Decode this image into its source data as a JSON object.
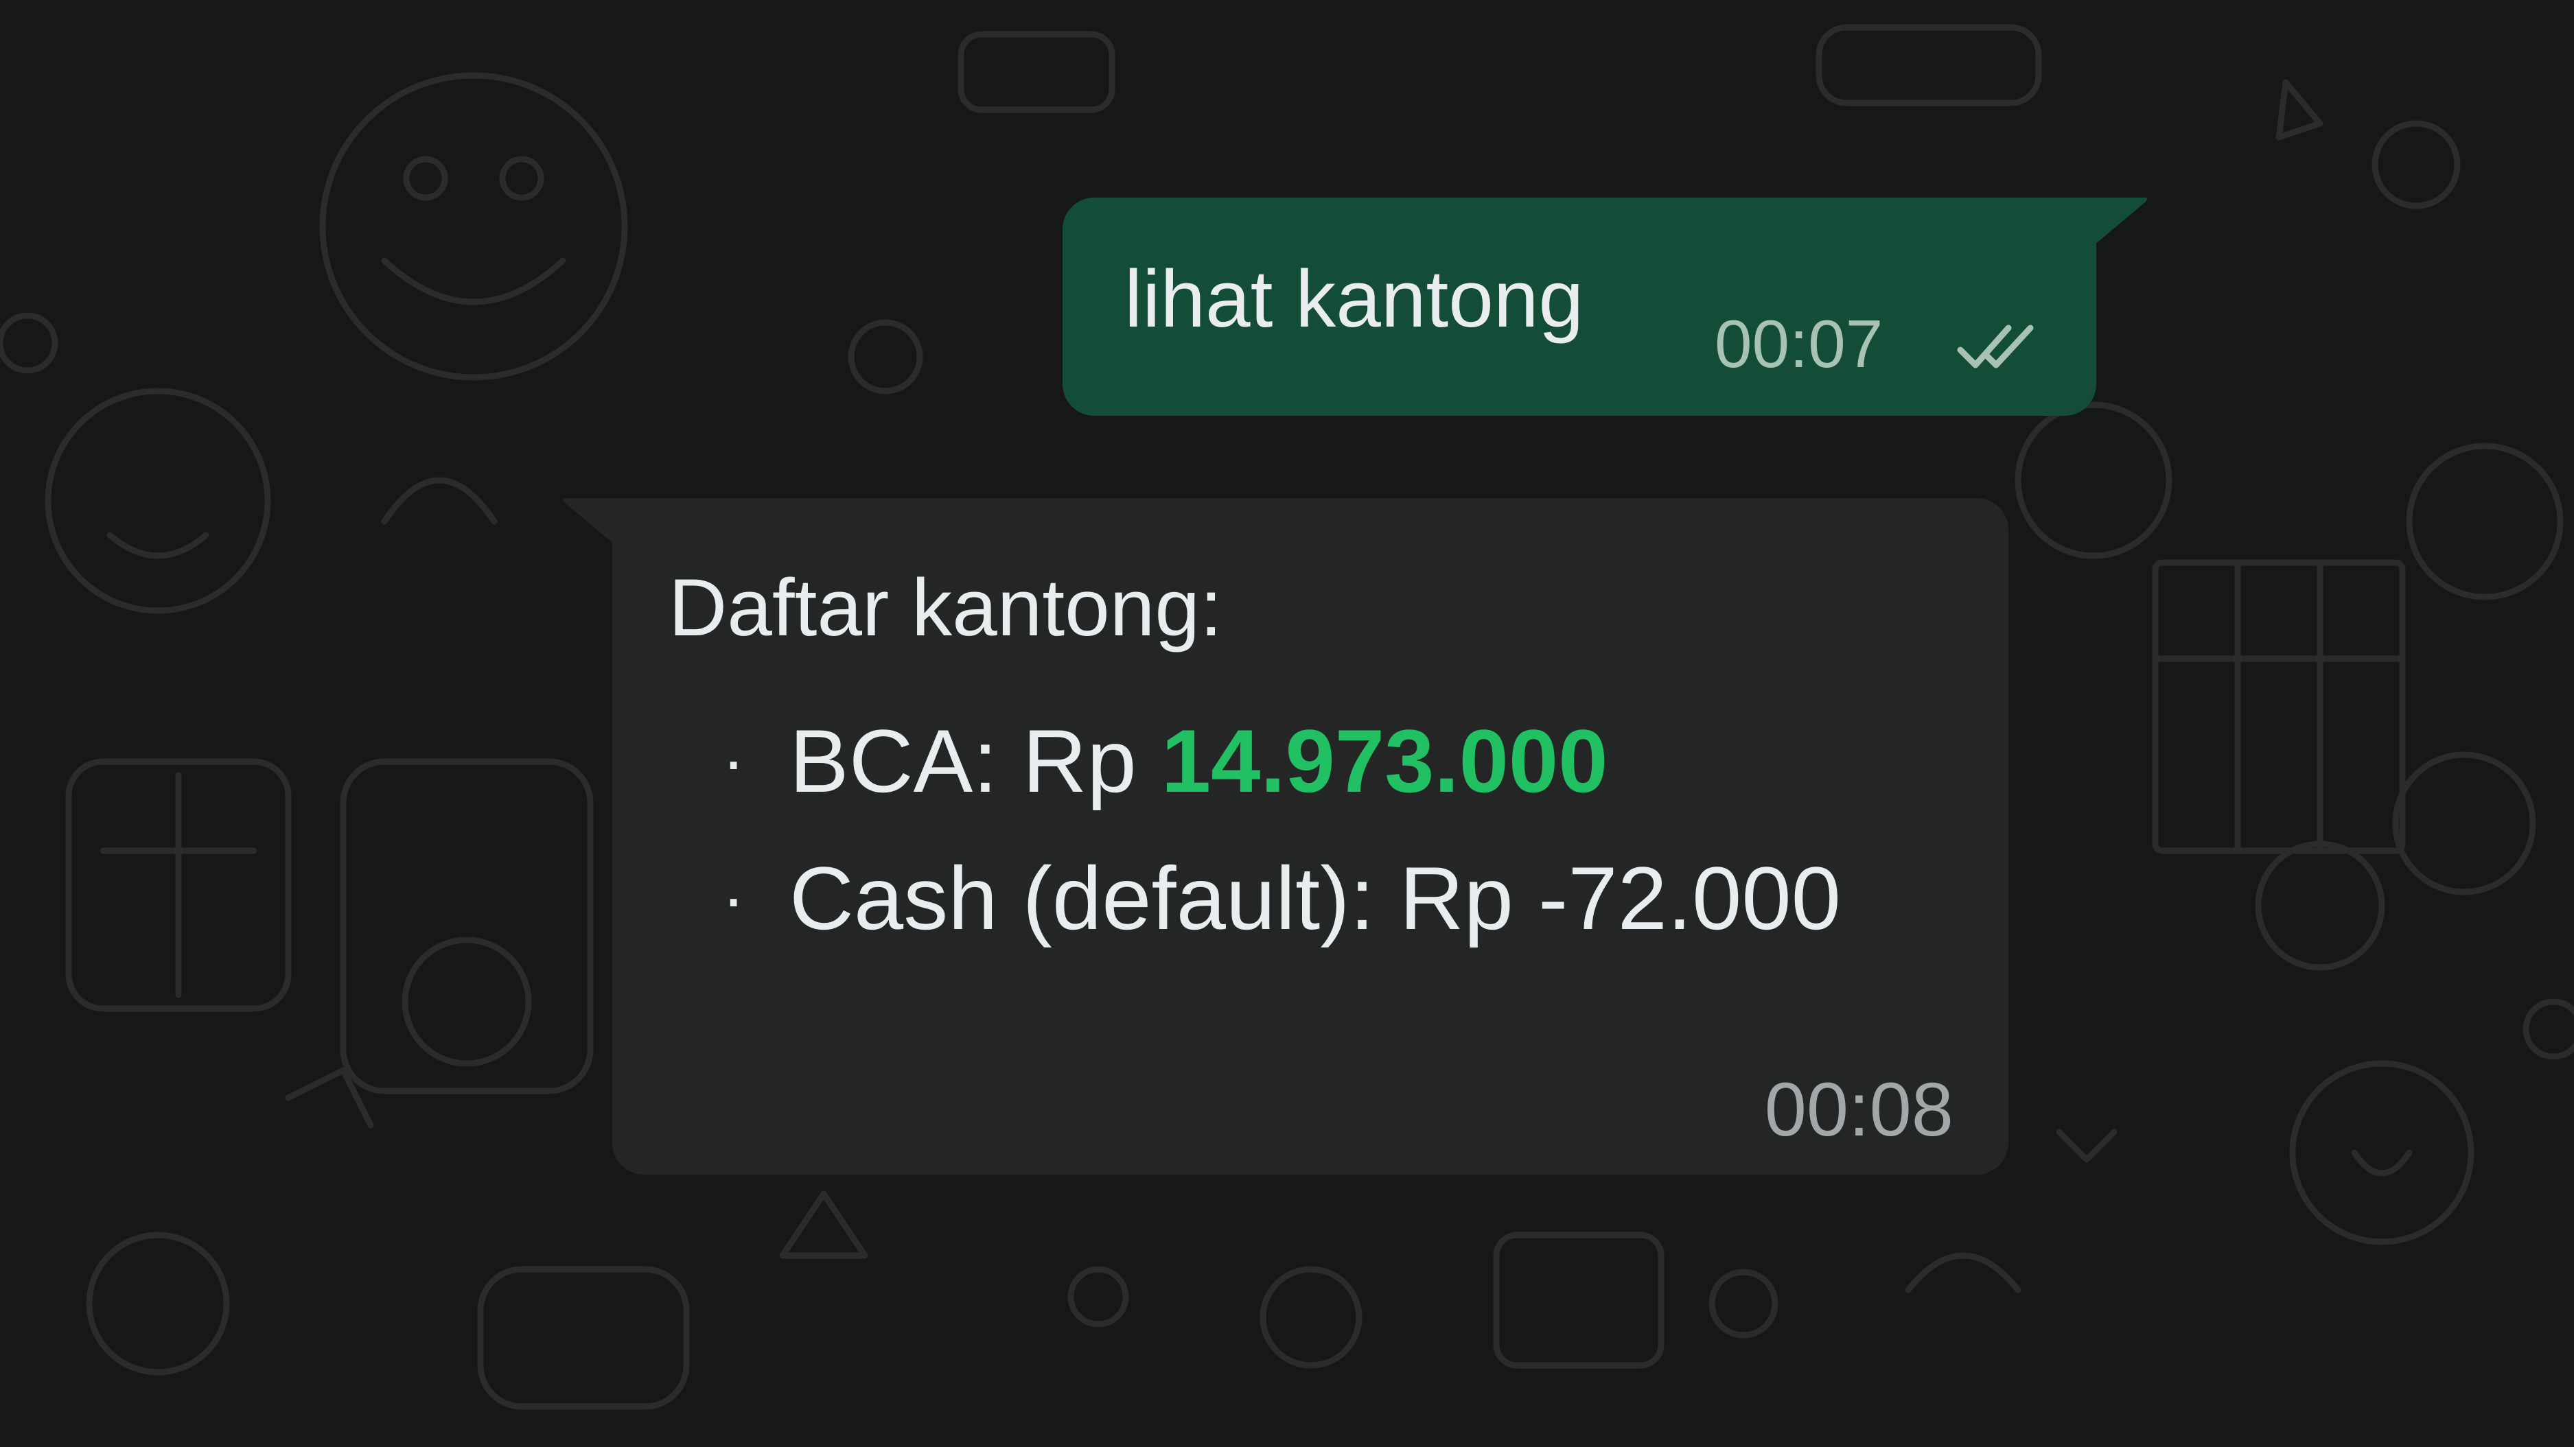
{
  "chat": {
    "outgoing": {
      "text": "lihat kantong",
      "time": "00:07",
      "status_icon": "double-check-icon"
    },
    "incoming": {
      "title": "Daftar kantong:",
      "items": [
        {
          "bullet": "·",
          "label": "BCA: Rp ",
          "amount": "14.973.000"
        },
        {
          "bullet": "·",
          "label": "Cash (default): Rp -72.000"
        }
      ],
      "time": "00:08"
    }
  },
  "colors": {
    "background": "#161717",
    "outgoing_bubble": "#144d37",
    "incoming_bubble": "#242626",
    "positive_amount": "#21c063"
  }
}
